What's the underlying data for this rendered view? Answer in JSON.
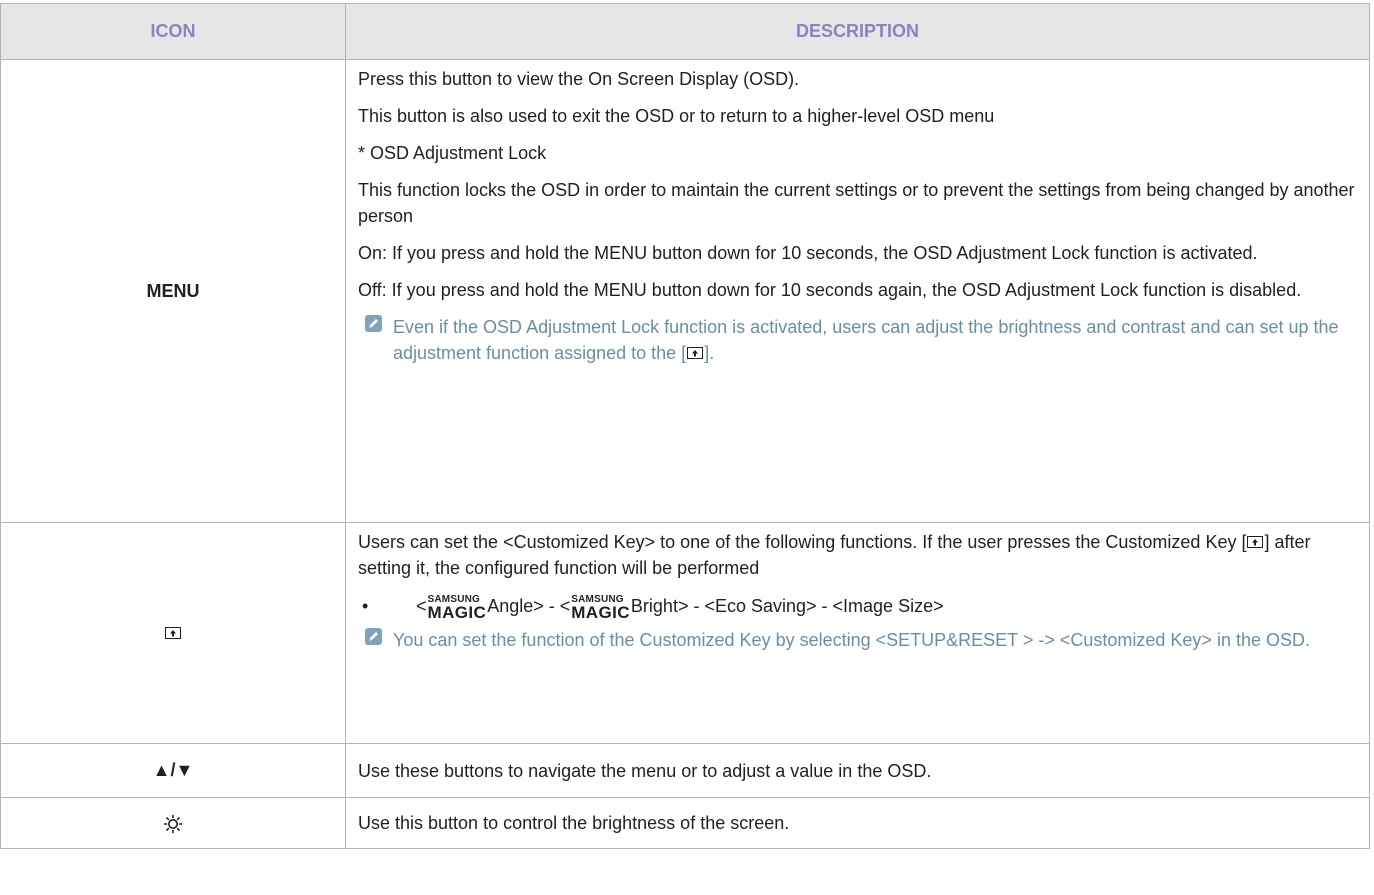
{
  "table": {
    "headers": {
      "icon": "ICON",
      "description": "DESCRIPTION"
    },
    "rows": {
      "menu": {
        "icon_label": "MENU",
        "paragraphs": [
          "Press this button to view the On Screen Display (OSD).",
          "This button is also used to exit the OSD or to return to a higher-level OSD menu",
          "* OSD Adjustment Lock",
          "This function locks the OSD in order to maintain the current settings or to prevent the settings from being changed by another person",
          "On: If you press and hold the MENU button down for 10 seconds, the OSD Adjustment Lock function is activated.",
          "Off: If you press and hold the MENU button down for 10 seconds again, the OSD Adjustment Lock function is disabled."
        ],
        "note_text": "Even if the OSD Adjustment Lock function is activated, users can adjust the brightness and contrast and can set up the adjustment function assigned to the [",
        "note_text_end": "]."
      },
      "customized_key": {
        "icon_name": "customized-key-icon",
        "intro_part1": "Users can set the <Customized Key> to one of the following functions. If the user presses the Customized Key [",
        "intro_part2": "] after setting it, the configured function will be performed",
        "bullet_symbol": "•",
        "bullet": {
          "open1": "<",
          "magic_top": "SAMSUNG",
          "magic_bottom": "MAGIC",
          "angle": "Angle> - <",
          "bright": "Bright> - <Eco Saving> - <Image Size>"
        },
        "note_text": "You can set the function of the Customized Key by selecting <SETUP&RESET > -> <Customized Key> in the OSD."
      },
      "arrows": {
        "icon_label": "▲/▼",
        "description": "Use these buttons to navigate the menu or to adjust a value in the OSD."
      },
      "brightness": {
        "icon_name": "brightness-sun-icon",
        "description": "Use this button to control the brightness of the screen."
      }
    }
  },
  "colors": {
    "header_text": "#8c84bd",
    "header_bg": "#e6e6e6",
    "note_text": "#6a8ea6",
    "border": "#b4b4b4"
  }
}
